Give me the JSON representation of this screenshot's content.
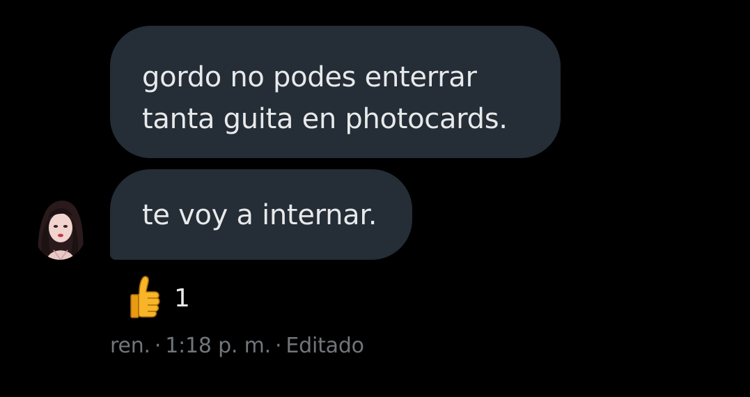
{
  "messages": [
    {
      "text": "gordo no podes enterrar\ntanta guita en photocards."
    },
    {
      "text": "te voy a internar."
    }
  ],
  "reaction": {
    "emoji_icon": "thumbs-up-icon",
    "count": "1"
  },
  "meta": {
    "sender": "ren.",
    "separator": "·",
    "time": "1:18 p. m.",
    "edited": "Editado"
  },
  "colors": {
    "background": "#000000",
    "bubble": "#252d36",
    "text": "#e7e9ea",
    "meta_text": "#71767b"
  }
}
